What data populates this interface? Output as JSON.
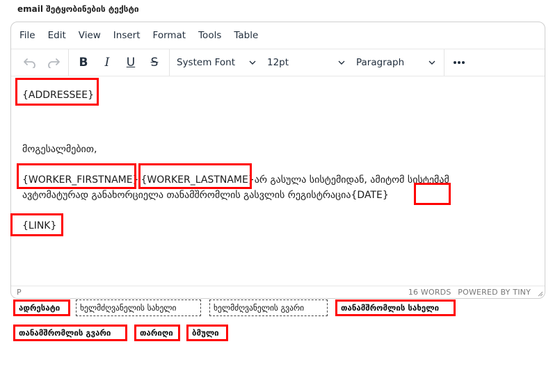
{
  "field_label": "email შეტყობინების ტექსტი",
  "menubar": [
    "File",
    "Edit",
    "View",
    "Insert",
    "Format",
    "Tools",
    "Table"
  ],
  "toolbar": {
    "undo_icon": "undo-icon",
    "redo_icon": "redo-icon",
    "bold": "B",
    "italic": "I",
    "underline": "U",
    "strike": "S",
    "font_family": "System Font",
    "font_size": "12pt",
    "block_format": "Paragraph",
    "more_icon": "more-icon"
  },
  "content": {
    "addressee": "{ADDRESSEE}",
    "greeting": "მოგესალმებით,",
    "worker_firstname": "{WORKER_FIRSTNAME}",
    "worker_lastname": "{WORKER_LASTNAME}",
    "line1_tail": "არ გასულა სისტემიდან, ამიტომ სისტემამ",
    "line2": "ავტომატურად განახორციელა თანამშრომლის გასვლის რეგისტრაცია",
    "date": "{DATE}",
    "link": "{LINK}"
  },
  "statusbar": {
    "path": "P",
    "words": "16 WORDS",
    "powered": "POWERED BY TINY"
  },
  "tokens": [
    {
      "label": "ადრესატი",
      "highlighted": true
    },
    {
      "label": "ხელმძღვანელის სახელი",
      "highlighted": false
    },
    {
      "label": "ხელმძღვანელის გვარი",
      "highlighted": false
    },
    {
      "label": "თანამშრომლის სახელი",
      "highlighted": true
    },
    {
      "label": "თანამშრომლის გვარი",
      "highlighted": true
    },
    {
      "label": "თარიღი",
      "highlighted": true
    },
    {
      "label": "ბმული",
      "highlighted": true
    }
  ],
  "colors": {
    "highlight": "#ff0000",
    "text": "#222f3e",
    "disabled_icon": "#b5b9bf"
  }
}
